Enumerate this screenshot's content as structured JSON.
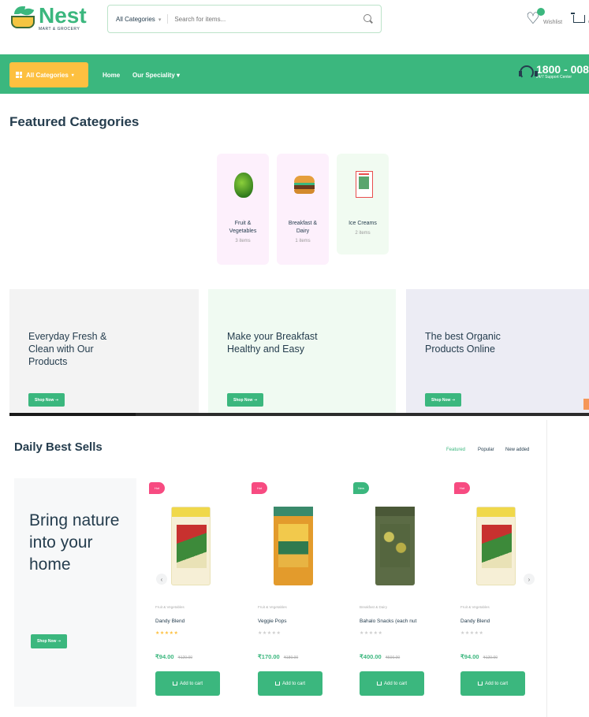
{
  "header": {
    "logo_name": "Nest",
    "logo_tagline": "MART & GROCERY",
    "search_category": "All Categories",
    "search_placeholder": "Search for items...",
    "wishlist_label": "Wishlist",
    "cart_label": "Ca"
  },
  "nav": {
    "browse_label": "All Categories",
    "links": [
      "Home",
      "Our Speciality"
    ],
    "support_number": "1800 - 008",
    "support_sub": "24/7 Support Center"
  },
  "featured": {
    "title": "Featured Categories",
    "categories": [
      {
        "name_line1": "Fruit &",
        "name_line2": "Vegetables",
        "count": "3 items",
        "bg": "#fdf0fc"
      },
      {
        "name_line1": "Breakfast &",
        "name_line2": "Dairy",
        "count": "1 items",
        "bg": "#fdf0fc"
      },
      {
        "name_line1": "Ice Creams",
        "name_line2": "",
        "count": "2 items",
        "bg": "#f1fbf1"
      }
    ]
  },
  "banners": [
    {
      "line1": "Everyday Fresh &",
      "line2": "Clean with Our",
      "line3": "Products",
      "button": "Shop Now",
      "bg": "#f3f3f3"
    },
    {
      "line1": "Make your Breakfast",
      "line2": "Healthy and Easy",
      "line3": "",
      "button": "Shop Now",
      "bg": "#f0faf2"
    },
    {
      "line1": "The best Organic",
      "line2": "Products Online",
      "line3": "",
      "button": "Shop Now",
      "bg": "#ececf4"
    }
  ],
  "daily": {
    "title": "Daily Best Sells",
    "tabs": [
      "Featured",
      "Popular",
      "New added"
    ],
    "promo_line1": "Bring nature",
    "promo_line2": "into your",
    "promo_line3": "home",
    "promo_button": "Shop Now",
    "products": [
      {
        "tag": "Hot",
        "tag_color": "#f74b81",
        "category": "Fruit & Vegetables",
        "name": "Dandy Blend",
        "rating": 5,
        "price": "₹94.00",
        "old_price": "₹120.00",
        "button": "Add to cart"
      },
      {
        "tag": "Hot",
        "tag_color": "#f74b81",
        "category": "Fruit & Vegetables",
        "name": "Veggie Pops",
        "rating": 0,
        "price": "₹170.00",
        "old_price": "₹180.00",
        "button": "Add to cart"
      },
      {
        "tag": "New",
        "tag_color": "#3bb77e",
        "category": "Breakfast & Dairy",
        "name": "Bahalo Snacks (each nut",
        "rating": 0,
        "price": "₹400.00",
        "old_price": "₹500.00",
        "button": "Add to cart"
      },
      {
        "tag": "Hot",
        "tag_color": "#f74b81",
        "category": "Fruit & Vegetables",
        "name": "Dandy Blend",
        "rating": 0,
        "price": "₹94.00",
        "old_price": "₹120.00",
        "button": "Add to cart"
      }
    ]
  },
  "colors": {
    "brand_green": "#3bb77e",
    "accent_yellow": "#fdc040",
    "text_dark": "#253d4e"
  }
}
